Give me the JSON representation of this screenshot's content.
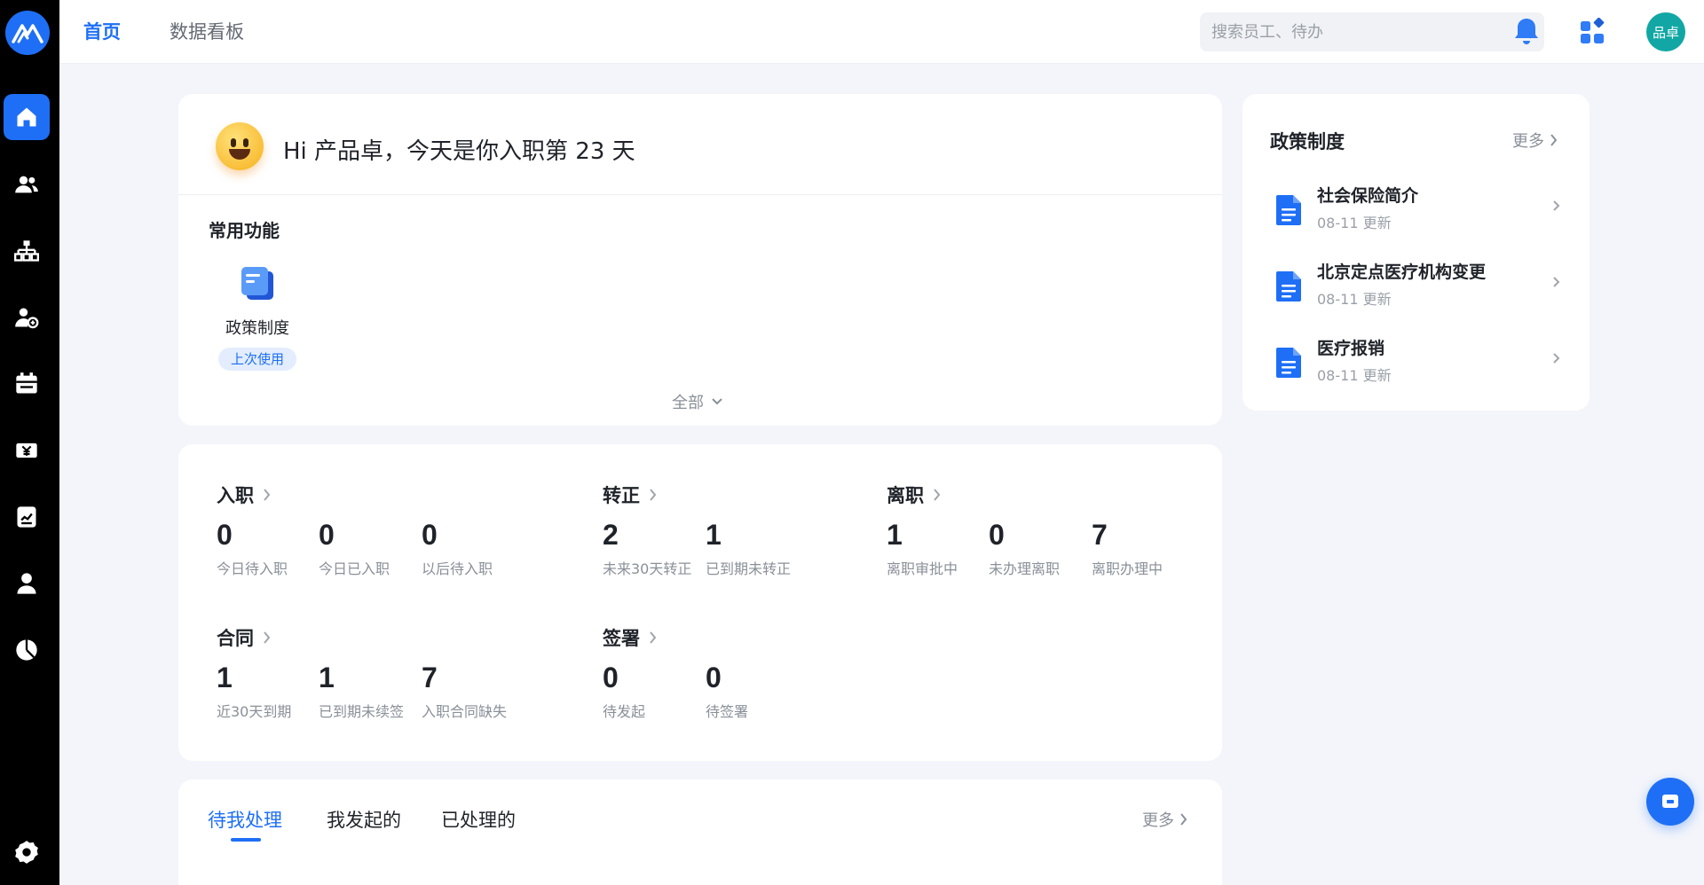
{
  "topnav": {
    "tabs": [
      {
        "label": "首页",
        "active": true
      },
      {
        "label": "数据看板",
        "active": false
      }
    ],
    "search_placeholder": "搜索员工、待办",
    "avatar_text": "品卓"
  },
  "sidebar": {
    "items": [
      {
        "icon": "home-icon",
        "active": true
      },
      {
        "icon": "people-icon"
      },
      {
        "icon": "org-chart-icon"
      },
      {
        "icon": "user-add-icon"
      },
      {
        "icon": "calendar-icon"
      },
      {
        "icon": "salary-icon"
      },
      {
        "icon": "report-icon"
      },
      {
        "icon": "person-icon"
      },
      {
        "icon": "pie-chart-icon"
      },
      {
        "icon": "settings-icon"
      }
    ]
  },
  "welcome": {
    "greeting": "Hi 产品卓，今天是你入职第 23 天",
    "common_title": "常用功能",
    "functions": [
      {
        "label": "政策制度",
        "badge": "上次使用"
      }
    ],
    "all_label": "全部"
  },
  "policy": {
    "title": "政策制度",
    "more_label": "更多",
    "docs": [
      {
        "name": "社会保险简介",
        "updated": "08-11 更新"
      },
      {
        "name": "北京定点医疗机构变更",
        "updated": "08-11 更新"
      },
      {
        "name": "医疗报销",
        "updated": "08-11 更新"
      }
    ]
  },
  "stats": {
    "groups": [
      {
        "title": "入职",
        "items": [
          {
            "value": "0",
            "label": "今日待入职"
          },
          {
            "value": "0",
            "label": "今日已入职"
          },
          {
            "value": "0",
            "label": "以后待入职"
          }
        ]
      },
      {
        "title": "转正",
        "items": [
          {
            "value": "2",
            "label": "未来30天转正"
          },
          {
            "value": "1",
            "label": "已到期未转正"
          }
        ]
      },
      {
        "title": "离职",
        "items": [
          {
            "value": "1",
            "label": "离职审批中"
          },
          {
            "value": "0",
            "label": "未办理离职"
          },
          {
            "value": "7",
            "label": "离职办理中"
          }
        ]
      },
      {
        "title": "合同",
        "items": [
          {
            "value": "1",
            "label": "近30天到期"
          },
          {
            "value": "1",
            "label": "已到期未续签"
          },
          {
            "value": "7",
            "label": "入职合同缺失"
          }
        ]
      },
      {
        "title": "签署",
        "items": [
          {
            "value": "0",
            "label": "待发起"
          },
          {
            "value": "0",
            "label": "待签署"
          }
        ]
      }
    ]
  },
  "todo": {
    "tabs": [
      {
        "label": "待我处理",
        "active": true
      },
      {
        "label": "我发起的",
        "active": false
      },
      {
        "label": "已处理的",
        "active": false
      }
    ],
    "more_label": "更多"
  },
  "colors": {
    "accent": "#1e6ff5",
    "sidebar_bg": "#000000",
    "page_bg": "#f3f5fa",
    "avatar_bg": "#12a7a4"
  }
}
